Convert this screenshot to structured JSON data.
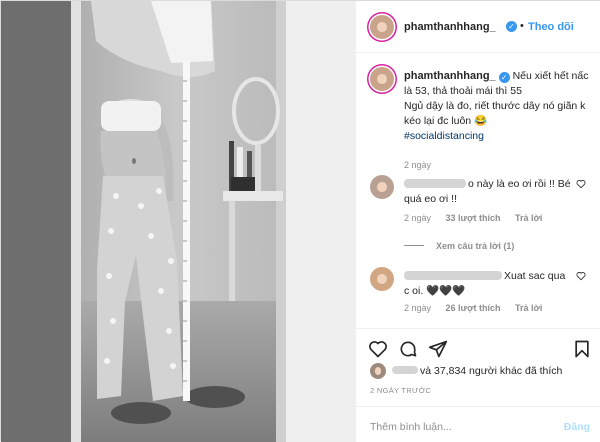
{
  "header": {
    "username": "phamthanhhang_",
    "separator": "•",
    "follow_label": "Theo dõi"
  },
  "caption": {
    "username": "phamthanhhang_",
    "line1": "Nếu xiết hết nấc là 53, thả thoải mái thì 55",
    "line2": "Ngủ dậy là đo, riết thước dây nó giãn k kéo lại đc luôn 😂",
    "hashtag": "#socialdistancing",
    "time": "2 ngày"
  },
  "comments": [
    {
      "text": "o này là eo ơi rồi !! Bé quá eo ơi !!",
      "time": "2 ngày",
      "likes": "33 lượt thích",
      "reply": "Trả lời"
    },
    {
      "text": "Xuat sac qua c oi. 🖤🖤🖤",
      "time": "2 ngày",
      "likes": "26 lượt thích",
      "reply": "Trả lời"
    }
  ],
  "view_replies": "Xem câu trả lời (1)",
  "likes_text": "và 37,834 người khác đã thích",
  "timestamp": "2 NGÀY TRƯỚC",
  "add_comment": {
    "placeholder": "Thêm bình luận...",
    "post_label": "Đăng"
  },
  "icons": {
    "verified": "verified-badge-icon",
    "like": "heart-icon",
    "comment": "comment-bubble-icon",
    "share": "paper-plane-icon",
    "save": "bookmark-icon"
  },
  "colors": {
    "link_blue": "#3897f0",
    "post_disabled": "#b2dffc",
    "muted": "#8e8e8e"
  }
}
